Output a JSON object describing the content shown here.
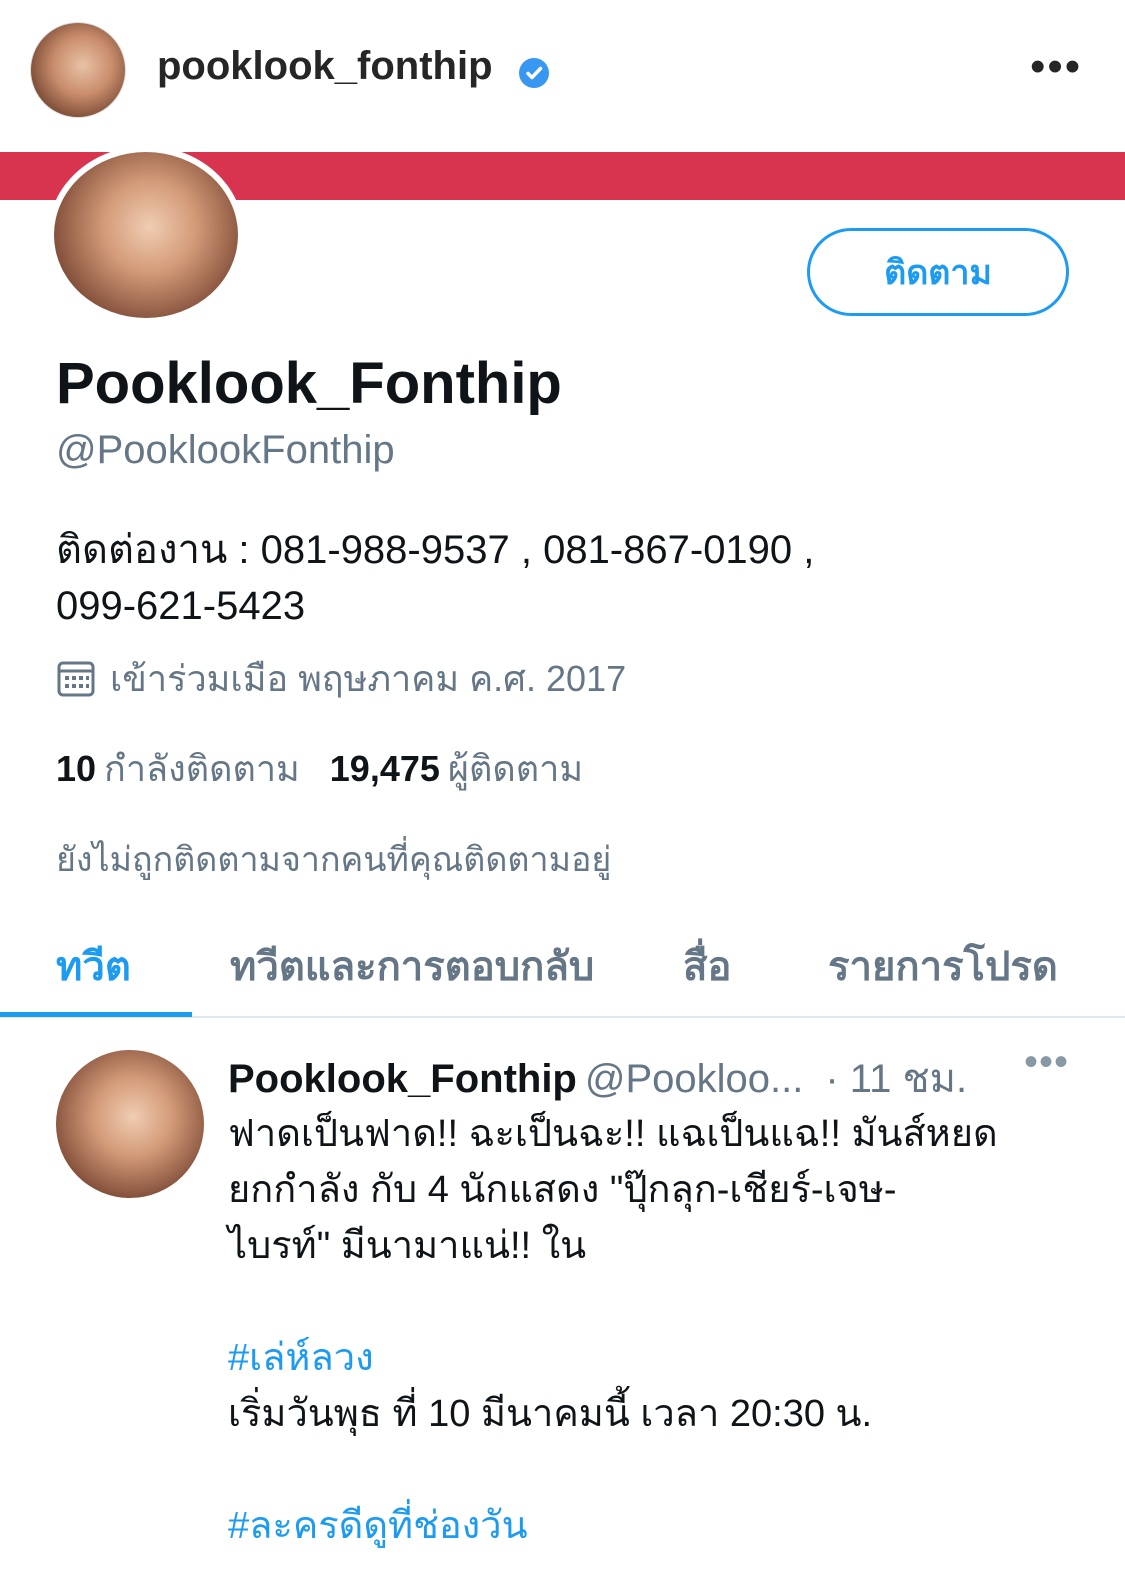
{
  "instagram": {
    "username": "pooklook_fonthip",
    "more_label": "•••"
  },
  "profile": {
    "follow_label": "ติดตาม",
    "display_name": "Pooklook_Fonthip",
    "handle": "@PooklookFonthip",
    "bio_line1": "ติดต่องาน : 081-988-9537 , 081-867-0190 ,",
    "bio_line2": "099-621-5423",
    "joined": "เข้าร่วมเมือ พฤษภาคม ค.ศ. 2017",
    "following_count": "10",
    "following_label": "กำลังติดตาม",
    "followers_count": "19,475",
    "followers_label": "ผู้ติดตาม",
    "not_followed_text": "ยังไม่ถูกติดตามจากคนที่คุณติดตามอยู่"
  },
  "tabs": [
    {
      "label": "ทวีต",
      "active": true
    },
    {
      "label": "ทวีตและการตอบกลับ",
      "active": false
    },
    {
      "label": "สื่อ",
      "active": false
    },
    {
      "label": "รายการโปรด",
      "active": false
    }
  ],
  "tweet": {
    "name": "Pooklook_Fonthip",
    "handle": "@Pookloo...",
    "time": "· 11 ชม.",
    "more": "•••",
    "line1": "ฟาดเป็นฟาด!! ฉะเป็นฉะ!! แฉเป็นแฉ!! มันส์หยด",
    "line2": "ยกกำลัง กับ 4 นักแสดง \"ปุ๊กลุก-เชียร์-เจษ-",
    "line3": "ไบรท์\" มีนามาแน่!! ใน",
    "hashtag1": "#เล่ห์ลวง",
    "line4": "เริ่มวันพุธ ที่ 10 มีนาคมนี้ เวลา 20:30 น.",
    "hashtag2": "#ละครดีดูที่ช่องวัน"
  },
  "colors": {
    "accent": "#1d9bf0",
    "banner": "#d9344f",
    "secondary_text": "#657786"
  },
  "icons": {
    "verified": "verified-badge-icon",
    "calendar": "calendar-icon",
    "more": "more-dots-icon"
  }
}
